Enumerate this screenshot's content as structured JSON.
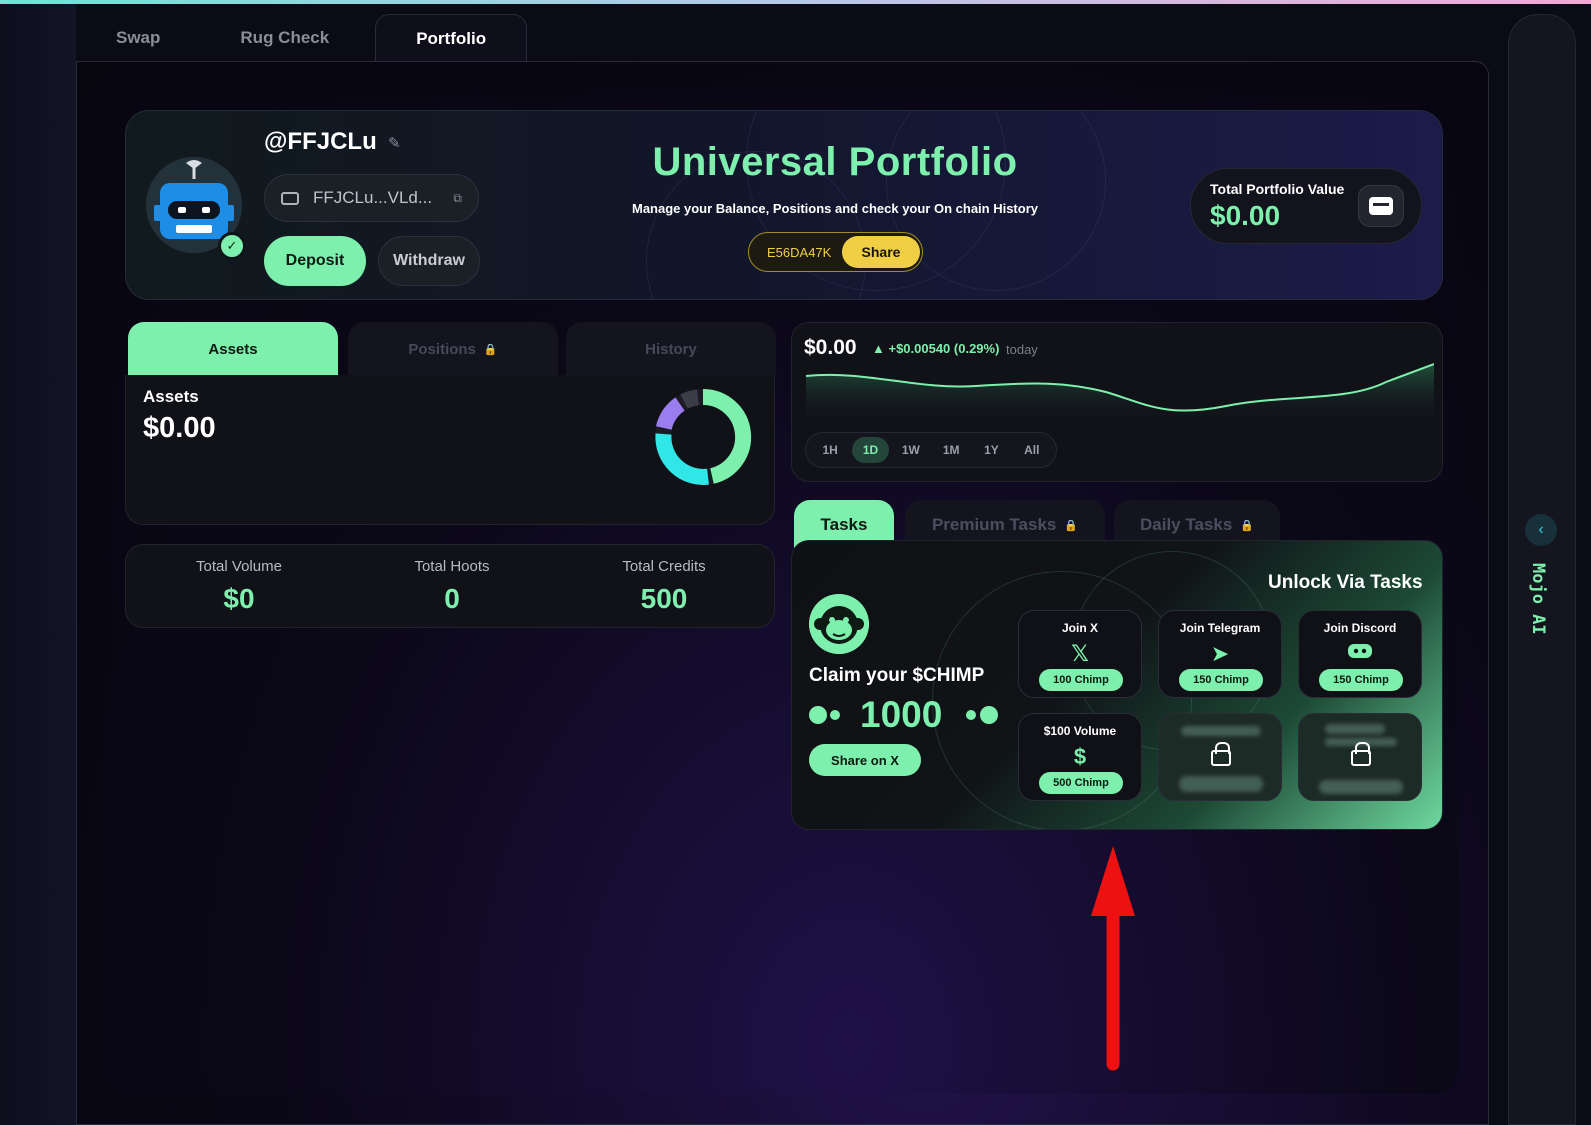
{
  "top_tabs": [
    "Swap",
    "Rug Check",
    "Portfolio"
  ],
  "profile": {
    "username": "@FFJCLu",
    "address": "FFJCLu...VLd...",
    "deposit": "Deposit",
    "withdraw": "Withdraw"
  },
  "header": {
    "title": "Universal Portfolio",
    "subtitle": "Manage your Balance, Positions and check your On chain History",
    "ref_code": "E56DA47K",
    "share": "Share",
    "tpv_label": "Total Portfolio Value",
    "tpv_value": "$0.00"
  },
  "asset_tabs": [
    "Assets",
    "Positions",
    "History"
  ],
  "assets": {
    "label": "Assets",
    "value": "$0.00"
  },
  "stats": [
    {
      "label": "Total Volume",
      "value": "$0"
    },
    {
      "label": "Total Hoots",
      "value": "0"
    },
    {
      "label": "Total Credits",
      "value": "500"
    }
  ],
  "chart": {
    "value": "$0.00",
    "change": "▲ +$0.00540 (0.29%)",
    "period": "today",
    "ranges": [
      "1H",
      "1D",
      "1W",
      "1M",
      "1Y",
      "All"
    ],
    "active_range": "1D"
  },
  "task_tabs": [
    "Tasks",
    "Premium Tasks",
    "Daily Tasks"
  ],
  "tasks": {
    "unlock_title": "Unlock Via Tasks",
    "claim": "Claim your $CHIMP",
    "amount": "1000",
    "share_x": "Share on X",
    "cards": [
      {
        "title": "Join X",
        "icon": "x-logo-icon",
        "reward": "100 Chimp"
      },
      {
        "title": "Join Telegram",
        "icon": "telegram-icon",
        "reward": "150 Chimp"
      },
      {
        "title": "Join Discord",
        "icon": "discord-icon",
        "reward": "150 Chimp"
      },
      {
        "title": "$100 Volume",
        "icon": "dollar-icon",
        "reward": "500 Chimp"
      }
    ]
  },
  "side": {
    "label": "Mojo AI"
  },
  "colors": {
    "accent": "#7ef0ad",
    "gold": "#f0cf45",
    "cyan": "#31e6e6",
    "purple": "#9b7df0"
  }
}
